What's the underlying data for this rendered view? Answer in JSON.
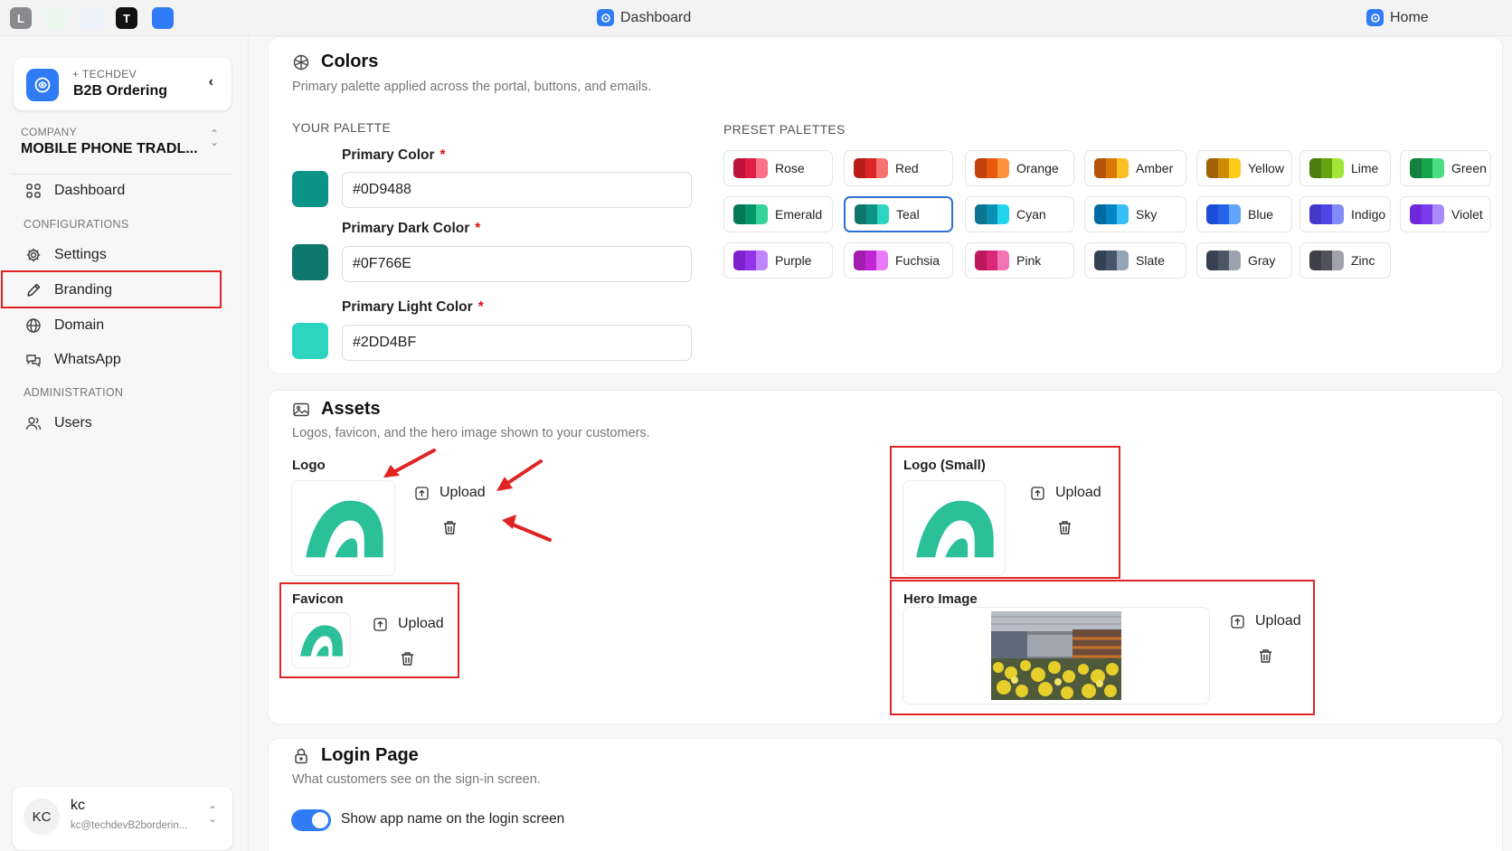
{
  "topbar": {
    "tabs": [
      {
        "icon": "l-app-icon",
        "letter": "L",
        "bg": "#8a8a8e",
        "fg": "#ffffff"
      },
      {
        "icon": "green-app-icon",
        "letter": "",
        "bg": "#e9f7ec",
        "fg": "#18a34a"
      },
      {
        "icon": "location-pin-icon",
        "letter": "",
        "bg": "#eef2fb",
        "fg": "#2f7cf6"
      },
      {
        "icon": "t-app-icon",
        "letter": "T",
        "bg": "#111111",
        "fg": "#ffffff"
      },
      {
        "icon": "blue-app-icon",
        "letter": "",
        "bg": "#2f7cf6",
        "fg": "#ffffff"
      }
    ],
    "center_title": "Dashboard",
    "right_title": "Home"
  },
  "sidebar": {
    "brand_sub": "+ TECHDEV",
    "brand_name": "B2B Ordering",
    "company_label": "COMPANY",
    "company_name": "MOBILE PHONE TRADL...",
    "nav": {
      "dashboard": "Dashboard",
      "section_config": "CONFIGURATIONS",
      "settings": "Settings",
      "branding": "Branding",
      "domain": "Domain",
      "whatsapp": "WhatsApp",
      "section_admin": "ADMINISTRATION",
      "users": "Users"
    },
    "user": {
      "initials": "KC",
      "name": "kc",
      "email": "kc@techdevB2borderin..."
    }
  },
  "colors_section": {
    "title": "Colors",
    "description": "Primary palette applied across the portal, buttons, and emails.",
    "your_palette_label": "YOUR PALETTE",
    "preset_label": "PRESET PALETTES",
    "primary": {
      "label": "Primary Color",
      "value": "#0D9488"
    },
    "primary_dark": {
      "label": "Primary Dark Color",
      "value": "#0F766E"
    },
    "primary_light": {
      "label": "Primary Light Color",
      "value": "#2DD4BF"
    },
    "required_mark": "*",
    "presets": [
      {
        "name": "Rose",
        "colors": [
          "#be123c",
          "#e11d48",
          "#fb7185"
        ]
      },
      {
        "name": "Red",
        "colors": [
          "#b91c1c",
          "#dc2626",
          "#f87171"
        ]
      },
      {
        "name": "Orange",
        "colors": [
          "#c2410c",
          "#ea580c",
          "#fb923c"
        ]
      },
      {
        "name": "Amber",
        "colors": [
          "#b45309",
          "#d97706",
          "#fbbf24"
        ]
      },
      {
        "name": "Yellow",
        "colors": [
          "#a16207",
          "#ca8a04",
          "#facc15"
        ]
      },
      {
        "name": "Lime",
        "colors": [
          "#4d7c0f",
          "#65a30d",
          "#a3e635"
        ]
      },
      {
        "name": "Green",
        "colors": [
          "#15803d",
          "#16a34a",
          "#4ade80"
        ]
      },
      {
        "name": "Emerald",
        "colors": [
          "#047857",
          "#059669",
          "#34d399"
        ]
      },
      {
        "name": "Teal",
        "colors": [
          "#0f766e",
          "#0d9488",
          "#2dd4bf"
        ],
        "selected": true
      },
      {
        "name": "Cyan",
        "colors": [
          "#0e7490",
          "#0891b2",
          "#22d3ee"
        ]
      },
      {
        "name": "Sky",
        "colors": [
          "#0369a1",
          "#0284c7",
          "#38bdf8"
        ]
      },
      {
        "name": "Blue",
        "colors": [
          "#1d4ed8",
          "#2563eb",
          "#60a5fa"
        ]
      },
      {
        "name": "Indigo",
        "colors": [
          "#4338ca",
          "#4f46e5",
          "#818cf8"
        ]
      },
      {
        "name": "Violet",
        "colors": [
          "#6d28d9",
          "#7c3aed",
          "#a78bfa"
        ]
      },
      {
        "name": "Purple",
        "colors": [
          "#7e22ce",
          "#9333ea",
          "#c084fc"
        ]
      },
      {
        "name": "Fuchsia",
        "colors": [
          "#a21caf",
          "#c026d3",
          "#e879f9"
        ]
      },
      {
        "name": "Pink",
        "colors": [
          "#be185d",
          "#db2777",
          "#f472b6"
        ]
      },
      {
        "name": "Slate",
        "colors": [
          "#334155",
          "#475569",
          "#94a3b8"
        ]
      },
      {
        "name": "Gray",
        "colors": [
          "#374151",
          "#4b5563",
          "#9ca3af"
        ]
      },
      {
        "name": "Zinc",
        "colors": [
          "#3f3f46",
          "#52525b",
          "#a1a1aa"
        ]
      }
    ]
  },
  "assets_section": {
    "title": "Assets",
    "description": "Logos, favicon, and the hero image shown to your customers.",
    "logo_label": "Logo",
    "logo_small_label": "Logo (Small)",
    "favicon_label": "Favicon",
    "hero_label": "Hero Image",
    "upload_label": "Upload",
    "logo_color": "#2bbf9a"
  },
  "login_section": {
    "title": "Login Page",
    "description": "What customers see on the sign-in screen.",
    "toggle_label": "Show app name on the login screen",
    "toggle_on": true
  },
  "accent_color": "#2f7cf6",
  "highlight_color": "#e02424"
}
